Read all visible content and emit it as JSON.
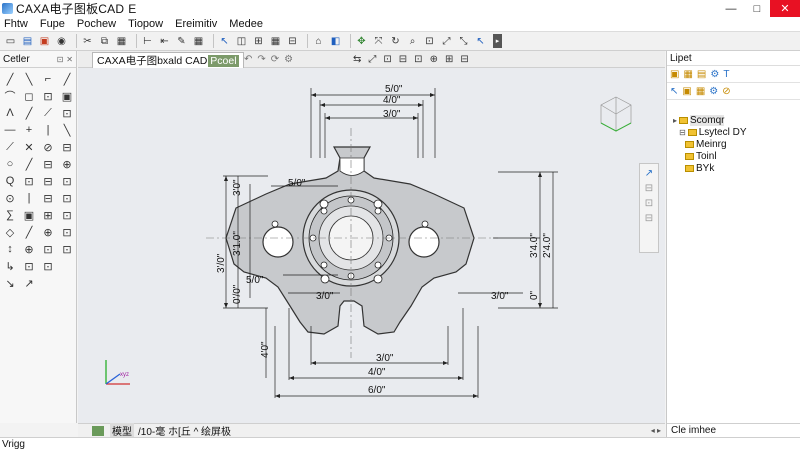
{
  "window": {
    "title": "CAXA电子图板CAD",
    "suffix": "E",
    "controls": [
      "—",
      "□",
      "✕"
    ]
  },
  "menu": [
    "Fhtw",
    "Fupe",
    "Pochew",
    "Tiopow",
    "Ereimitiv",
    "Medee"
  ],
  "left_panel": {
    "title": "Cetler",
    "tools": [
      "╱",
      "╲",
      "⌐",
      "╱",
      "⌒",
      "◻",
      "⊡",
      "▣",
      "Λ",
      "╱",
      "⟋",
      "⊡",
      "—",
      "+",
      "|",
      "╲",
      "⟋",
      "✕",
      "⊘",
      "⊟",
      "○",
      "╱",
      "⊟",
      "⊕",
      "Q",
      "⊡",
      "⊟",
      "⊡",
      "⊙",
      "|",
      "⊟",
      "⊡",
      "∑",
      "▣",
      "⊞",
      "⊡",
      "◇",
      "╱",
      "⊕",
      "⊡",
      "↕",
      "⊕",
      "⊡",
      "⊡",
      "↳",
      "⊡",
      "⊡",
      "",
      "↘",
      "↗",
      "",
      ""
    ]
  },
  "document": {
    "tab_label": "CAXA电子图bxald CAD",
    "tab_tag": "Pcoel",
    "view_icons": [
      "⇆",
      "⤢",
      "⊡",
      "⊟",
      "⊡",
      "⊕",
      "⊞",
      "⊟"
    ]
  },
  "drawing": {
    "dims_top": [
      "5/0\"",
      "4/0\"",
      "3/0\""
    ],
    "dims_bottom": [
      "3/0\"",
      "4/0\"",
      "6/0\""
    ],
    "dims_left": [
      "3'/0\"",
      "3'0\"",
      "3'1.0\"",
      "0'/0\""
    ],
    "dims_right": [
      "3'4.0\"",
      "2'4.0\"",
      "0\""
    ],
    "dims_inner": [
      "5/0\"",
      "5/0\"",
      "3/0\"",
      "3/0\""
    ],
    "side_labels": [
      "4'0\"",
      "0'0\"",
      "5/0\""
    ]
  },
  "status_bar": {
    "layout_tab": "模型",
    "text": "/10-毫 ホ[丘 ^ 绘屏极"
  },
  "right_panel": {
    "title": "Lipet",
    "tree": [
      {
        "label": "Scomqr",
        "level": 0
      },
      {
        "label": "Lsytecl DY",
        "level": 1
      },
      {
        "label": "Meinrg",
        "level": 1
      },
      {
        "label": "Toinl",
        "level": 1
      },
      {
        "label": "BYk",
        "level": 1
      }
    ],
    "footer": "Cle imhee"
  },
  "command_line": "Vrigg"
}
